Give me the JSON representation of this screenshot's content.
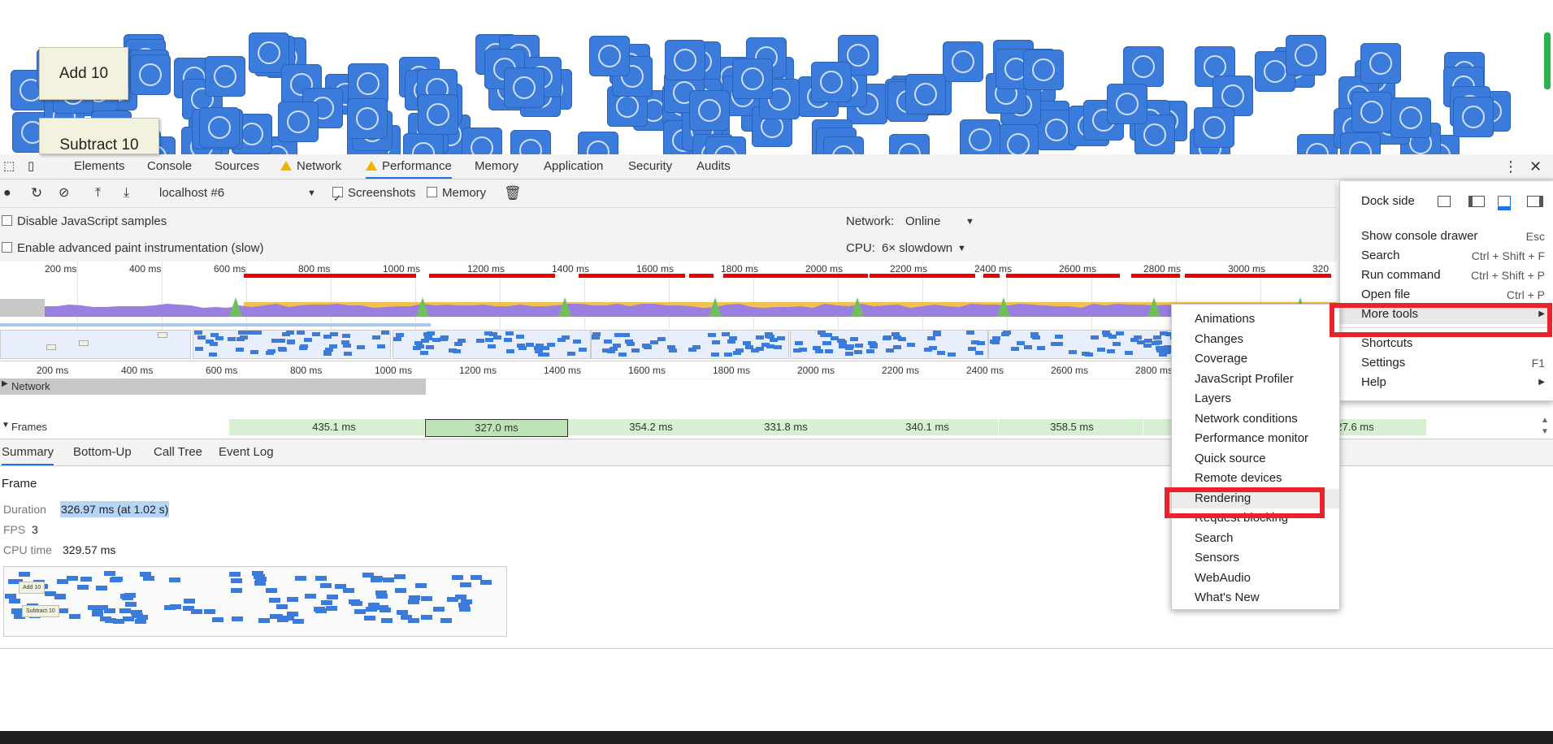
{
  "page": {
    "add_button": "Add 10",
    "subtract_button": "Subtract 10",
    "logo_icon": "chrome-logo-icon"
  },
  "devtools": {
    "tabs": [
      {
        "label": "Elements"
      },
      {
        "label": "Console"
      },
      {
        "label": "Sources"
      },
      {
        "label": "Network",
        "warning": true
      },
      {
        "label": "Performance",
        "warning": true,
        "active": true
      },
      {
        "label": "Memory"
      },
      {
        "label": "Application"
      },
      {
        "label": "Security"
      },
      {
        "label": "Audits"
      }
    ],
    "toolbar": {
      "profile_select": "localhost #6",
      "screenshots_label": "Screenshots",
      "screenshots_checked": true,
      "memory_label": "Memory",
      "memory_checked": false
    },
    "settings": {
      "disable_js_samples": "Disable JavaScript samples",
      "advanced_paint": "Enable advanced paint instrumentation (slow)",
      "network_label": "Network:",
      "network_value": "Online",
      "cpu_label": "CPU:",
      "cpu_value": "6× slowdown"
    },
    "overview_ticks": [
      "200 ms",
      "400 ms",
      "600 ms",
      "800 ms",
      "1000 ms",
      "1200 ms",
      "1400 ms",
      "1600 ms",
      "1800 ms",
      "2000 ms",
      "2200 ms",
      "2400 ms",
      "2600 ms",
      "2800 ms",
      "3000 ms",
      "320"
    ],
    "ruler_ticks": [
      "200 ms",
      "400 ms",
      "600 ms",
      "800 ms",
      "1000 ms",
      "1200 ms",
      "1400 ms",
      "1600 ms",
      "1800 ms",
      "2000 ms",
      "2200 ms",
      "2400 ms",
      "2600 ms",
      "2800 ms"
    ],
    "network_track": "Network",
    "frames_track": "Frames",
    "frames": [
      "435.1 ms",
      "327.0 ms",
      "354.2 ms",
      "331.8 ms",
      "340.1 ms",
      "358.5 ms",
      "27.6 ms"
    ],
    "bottom_tabs": [
      "Summary",
      "Bottom-Up",
      "Call Tree",
      "Event Log"
    ],
    "summary": {
      "title": "Frame",
      "duration_label": "Duration",
      "duration_value": "326.97 ms (at 1.02 s)",
      "fps_label": "FPS",
      "fps_value": "3",
      "cpu_label": "CPU time",
      "cpu_value": "329.57 ms",
      "thumb_add": "Add 10",
      "thumb_subtract": "Subtract 10"
    }
  },
  "menu": {
    "dock_side": "Dock side",
    "items": [
      {
        "label": "Show console drawer",
        "shortcut": "Esc"
      },
      {
        "label": "Search",
        "shortcut": "Ctrl + Shift + F"
      },
      {
        "label": "Run command",
        "shortcut": "Ctrl + Shift + P"
      },
      {
        "label": "Open file",
        "shortcut": "Ctrl + P"
      },
      {
        "label": "More tools",
        "shortcut": "",
        "submenu": true,
        "highlighted": true
      },
      {
        "label": "Shortcuts",
        "shortcut": ""
      },
      {
        "label": "Settings",
        "shortcut": "F1"
      },
      {
        "label": "Help",
        "shortcut": "",
        "submenu": true
      }
    ]
  },
  "more_tools": [
    "Animations",
    "Changes",
    "Coverage",
    "JavaScript Profiler",
    "Layers",
    "Network conditions",
    "Performance monitor",
    "Quick source",
    "Remote devices",
    "Rendering",
    "Request blocking",
    "Search",
    "Sensors",
    "WebAudio",
    "What's New"
  ],
  "colors": {
    "accent": "#1a73e8",
    "highlight_box": "#e8232b",
    "logo_blue": "#3a7bdc",
    "frame_green": "#d7f0d1"
  }
}
